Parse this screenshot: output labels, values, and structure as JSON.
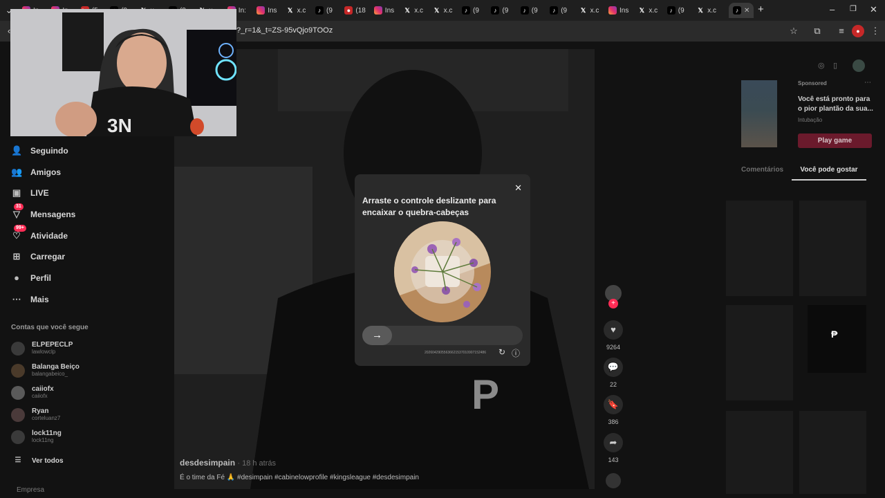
{
  "tabs": [
    {
      "icon": "instagram-icon",
      "label": "In"
    },
    {
      "icon": "instagram-icon",
      "label": "In"
    },
    {
      "icon": "youtube-icon",
      "label": "(5"
    },
    {
      "icon": "tiktok-icon",
      "label": "(9"
    },
    {
      "icon": "x-icon",
      "label": "x."
    },
    {
      "icon": "tiktok-icon",
      "label": "(9"
    },
    {
      "icon": "x-icon",
      "label": "x."
    },
    {
      "icon": "instagram-icon",
      "label": "In:"
    },
    {
      "icon": "instagram-icon",
      "label": "Ins"
    },
    {
      "icon": "x-icon",
      "label": "x.c"
    },
    {
      "icon": "tiktok-icon",
      "label": "(9"
    },
    {
      "icon": "twitch-icon",
      "label": "(18"
    },
    {
      "icon": "instagram-icon",
      "label": "Ins"
    },
    {
      "icon": "x-icon",
      "label": "x.c"
    },
    {
      "icon": "x-icon",
      "label": "x.c"
    },
    {
      "icon": "tiktok-icon",
      "label": "(9"
    },
    {
      "icon": "tiktok-icon",
      "label": "(9"
    },
    {
      "icon": "tiktok-icon",
      "label": "(9"
    },
    {
      "icon": "tiktok-icon",
      "label": "(9"
    },
    {
      "icon": "x-icon",
      "label": "x.c"
    },
    {
      "icon": "instagram-icon",
      "label": "Ins"
    },
    {
      "icon": "x-icon",
      "label": "x.c"
    },
    {
      "icon": "tiktok-icon",
      "label": "(9"
    },
    {
      "icon": "x-icon",
      "label": "x.c"
    }
  ],
  "browser": {
    "url": "?_r=1&_t=ZS-95vQjo9TOOz",
    "new_tab": "+",
    "minimize": "–",
    "restore": "❐",
    "close": "✕"
  },
  "sidebar": {
    "items": [
      {
        "label": "Seguindo",
        "icon": "following-icon",
        "badge": ""
      },
      {
        "label": "Amigos",
        "icon": "friends-icon",
        "badge": ""
      },
      {
        "label": "LIVE",
        "icon": "live-icon",
        "badge": ""
      },
      {
        "label": "Mensagens",
        "icon": "messages-icon",
        "badge": "31"
      },
      {
        "label": "Atividade",
        "icon": "activity-icon",
        "badge": "99+"
      },
      {
        "label": "Carregar",
        "icon": "upload-icon",
        "badge": ""
      },
      {
        "label": "Perfil",
        "icon": "profile-icon",
        "badge": ""
      },
      {
        "label": "Mais",
        "icon": "more-icon",
        "badge": ""
      }
    ],
    "following_title": "Contas que você segue",
    "following": [
      {
        "name": "ELPEPECLP",
        "handle": "lawlowclp"
      },
      {
        "name": "Balanga Beiço",
        "handle": "balangabeico_"
      },
      {
        "name": "caiiofx",
        "handle": "caiiofx"
      },
      {
        "name": "Ryan",
        "handle": "corteluanz7"
      },
      {
        "name": "lock11ng",
        "handle": "lock11ng"
      }
    ],
    "see_all": "Ver todos",
    "footer": "Empresa"
  },
  "video": {
    "author": "desdesimpain",
    "time": "· 18 h atrás",
    "caption": "É o time da Fé 🙏 #desimpain #cabinelowprofile #kingsleague #desdesimpain",
    "likes": "9264",
    "comments": "22",
    "saves": "386",
    "shares": "143"
  },
  "right_panel": {
    "sponsored": "Sponsored",
    "ad_text": "Você está pronto para o pior plantão da sua...",
    "ad_sub": "Intubação",
    "play_button": "Play game",
    "tab_comments": "Comentários",
    "tab_you_may_like": "Você pode gostar"
  },
  "modal": {
    "title": "Arraste o controle deslizante para encaixar o quebra-cabeças",
    "code": "20260429055636621537010907152486",
    "slider_icon": "→"
  },
  "colors": {
    "accent": "#fe2c55",
    "play_button": "#6b1a2c",
    "modal_bg": "#2a2a2a"
  }
}
